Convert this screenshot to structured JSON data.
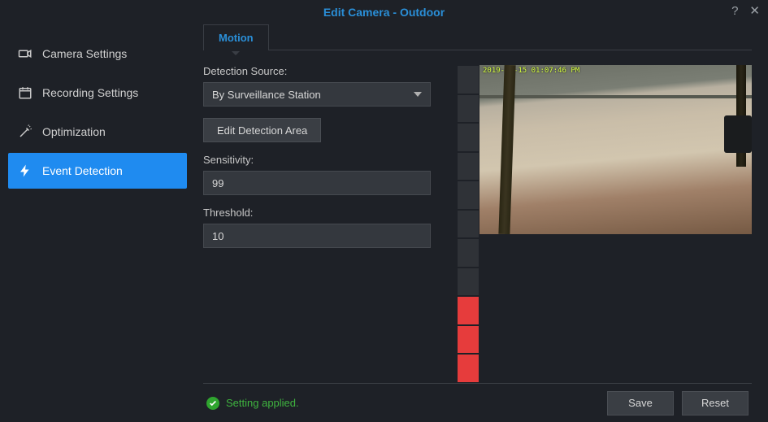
{
  "title": "Edit Camera - Outdoor",
  "sidebar": {
    "items": [
      {
        "label": "Camera Settings"
      },
      {
        "label": "Recording Settings"
      },
      {
        "label": "Optimization"
      },
      {
        "label": "Event Detection"
      }
    ]
  },
  "tabs": [
    {
      "label": "Motion"
    }
  ],
  "form": {
    "detection_source_label": "Detection Source:",
    "detection_source_value": "By Surveillance Station",
    "edit_area_label": "Edit Detection Area",
    "sensitivity_label": "Sensitivity:",
    "sensitivity_value": "99",
    "threshold_label": "Threshold:",
    "threshold_value": "10"
  },
  "preview": {
    "osd": "2019-06-15 01:07:46 PM"
  },
  "level_meter": {
    "total_cells": 11,
    "hot_from_bottom": 3
  },
  "footer": {
    "status": "Setting applied.",
    "save_label": "Save",
    "reset_label": "Reset"
  }
}
